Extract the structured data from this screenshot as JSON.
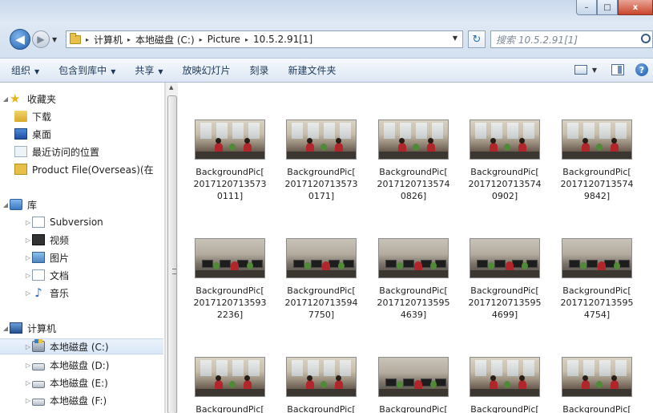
{
  "window": {
    "caption_buttons": {
      "minimize": "–",
      "maximize": "□",
      "close": "x"
    }
  },
  "address_bar": {
    "back_glyph": "◀",
    "forward_glyph": "▶",
    "crumbs": [
      "计算机",
      "本地磁盘 (C:)",
      "Picture",
      "10.5.2.91[1]"
    ],
    "separator": "▸",
    "refresh_glyph": "↻",
    "search_placeholder": "搜索 10.5.2.91[1]"
  },
  "toolbar": {
    "organize": "组织",
    "include_in_library": "包含到库中",
    "share": "共享",
    "slideshow": "放映幻灯片",
    "burn": "刻录",
    "new_folder": "新建文件夹",
    "help_glyph": "?"
  },
  "nav": {
    "favorites": {
      "label": "收藏夹",
      "items": [
        "下载",
        "桌面",
        "最近访问的位置",
        "Product File(Overseas)(在"
      ]
    },
    "libraries": {
      "label": "库",
      "items": [
        "Subversion",
        "视频",
        "图片",
        "文档",
        "音乐"
      ]
    },
    "computer": {
      "label": "计算机",
      "items": [
        "本地磁盘 (C:)",
        "本地磁盘 (D:)",
        "本地磁盘 (E:)",
        "本地磁盘 (F:)"
      ],
      "selected": "本地磁盘 (C:)"
    }
  },
  "files": [
    {
      "label": "BackgroundPic[\n2017120713573\n0111]",
      "scene": "a"
    },
    {
      "label": "BackgroundPic[\n2017120713573\n0171]",
      "scene": "a"
    },
    {
      "label": "BackgroundPic[\n2017120713574\n0826]",
      "scene": "a"
    },
    {
      "label": "BackgroundPic[\n2017120713574\n0902]",
      "scene": "a"
    },
    {
      "label": "BackgroundPic[\n2017120713574\n9842]",
      "scene": "a"
    },
    {
      "label": "BackgroundPic[\n2017120713593\n2236]",
      "scene": "b"
    },
    {
      "label": "BackgroundPic[\n2017120713594\n7750]",
      "scene": "b"
    },
    {
      "label": "BackgroundPic[\n2017120713595\n4639]",
      "scene": "b"
    },
    {
      "label": "BackgroundPic[\n2017120713595\n4699]",
      "scene": "b"
    },
    {
      "label": "BackgroundPic[\n2017120713595\n4754]",
      "scene": "b"
    },
    {
      "label": "BackgroundPic[",
      "scene": "a"
    },
    {
      "label": "BackgroundPic[",
      "scene": "a"
    },
    {
      "label": "BackgroundPic[",
      "scene": "b"
    },
    {
      "label": "BackgroundPic[",
      "scene": "a"
    },
    {
      "label": "BackgroundPic[",
      "scene": "a"
    }
  ]
}
